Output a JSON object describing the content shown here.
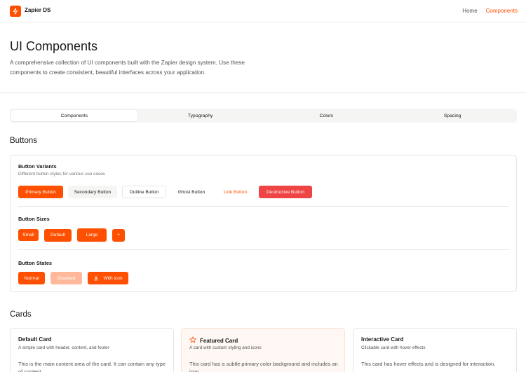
{
  "header": {
    "brand": "Zapier DS",
    "logo_icon": "lightning-icon",
    "nav": [
      {
        "label": "Home",
        "active": false
      },
      {
        "label": "Components",
        "active": true
      }
    ]
  },
  "hero": {
    "title": "UI Components",
    "description": "A comprehensive collection of UI components built with the Zapier design system. Use these components to create consistent, beautiful interfaces across your application."
  },
  "tabs": [
    {
      "label": "Components",
      "active": true
    },
    {
      "label": "Typography",
      "active": false
    },
    {
      "label": "Colors",
      "active": false
    },
    {
      "label": "Spacing",
      "active": false
    }
  ],
  "buttons_section": {
    "title": "Buttons",
    "variants": {
      "title": "Button Variants",
      "subtitle": "Different button styles for various use cases",
      "buttons": [
        "Primary Button",
        "Secondary Button",
        "Outline Button",
        "Ghost Button",
        "Link Button",
        "Destructive Button"
      ]
    },
    "sizes": {
      "title": "Button Sizes",
      "buttons": [
        "Small",
        "Default",
        "Large",
        "+"
      ]
    },
    "states": {
      "title": "Button States",
      "normal": "Normal",
      "disabled": "Disabled",
      "with_icon": "With icon",
      "with_icon_icon": "download-icon"
    }
  },
  "cards_section": {
    "title": "Cards",
    "cards": [
      {
        "title": "Default Card",
        "subtitle": "A simple card with header, content, and footer",
        "body": "This is the main content area of the card. It can contain any type of content."
      },
      {
        "title": "Featured Card",
        "subtitle": "A card with custom styling and icons",
        "body": "This card has a subtle primary color background and includes an icon.",
        "icon": "star-icon"
      },
      {
        "title": "Interactive Card",
        "subtitle": "Clickable card with hover effects",
        "body": "This card has hover effects and is designed for interaction."
      }
    ]
  },
  "colors": {
    "primary": "#ff4f00",
    "destructive": "#ef4444",
    "disabled": "#ffb899",
    "text": "#1c1917",
    "muted": "#57534e"
  }
}
